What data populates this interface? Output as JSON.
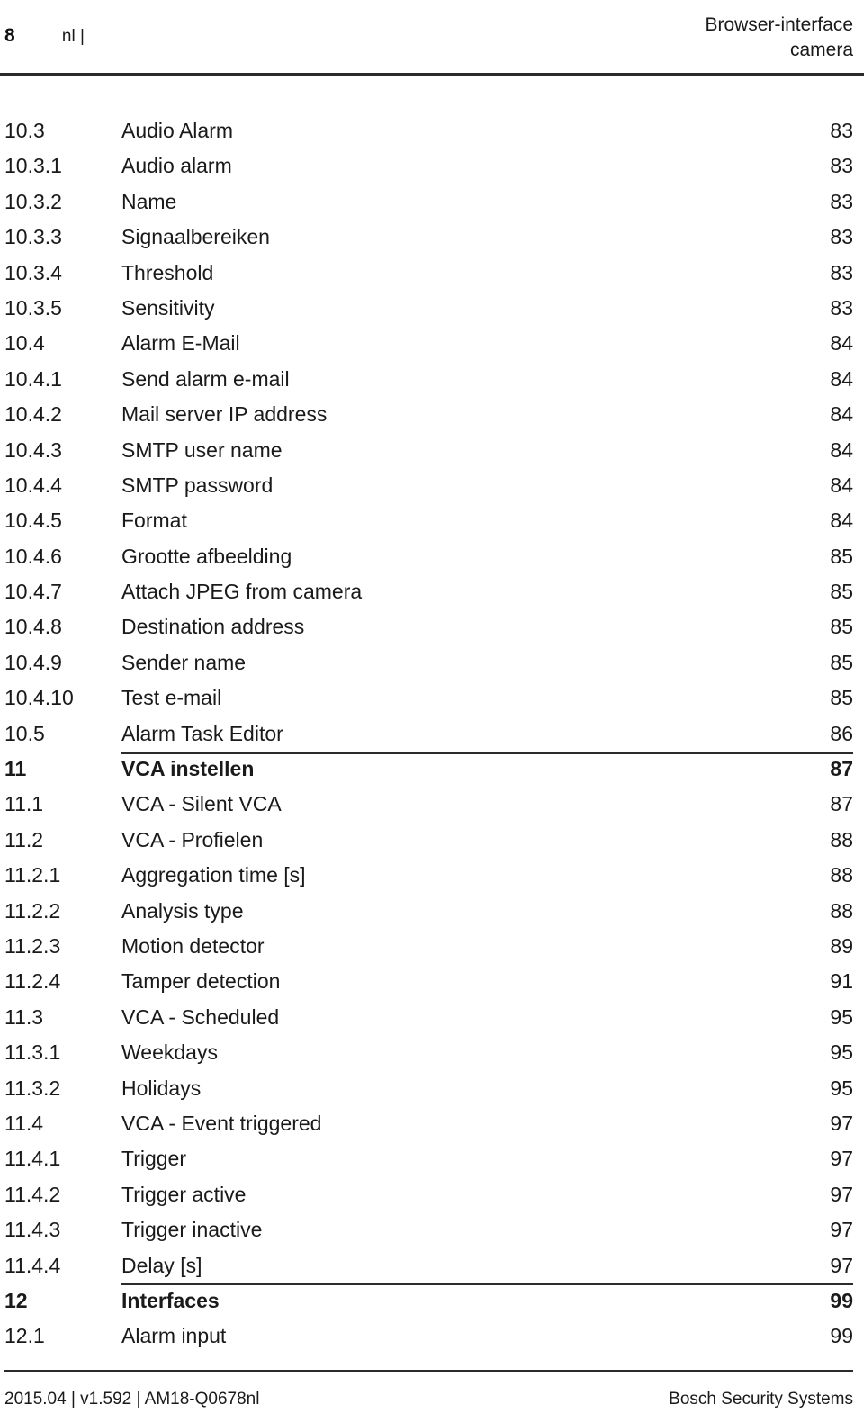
{
  "header": {
    "page_number": "8",
    "language": "nl |",
    "title_line1": "Browser-interface",
    "title_line2": "camera"
  },
  "toc": {
    "entries": [
      {
        "number": "10.3",
        "title": "Audio Alarm",
        "page": "83",
        "bold": false,
        "rule_above": false
      },
      {
        "number": "10.3.1",
        "title": "Audio alarm",
        "page": "83",
        "bold": false,
        "rule_above": false
      },
      {
        "number": "10.3.2",
        "title": "Name",
        "page": "83",
        "bold": false,
        "rule_above": false
      },
      {
        "number": "10.3.3",
        "title": "Signaalbereiken",
        "page": "83",
        "bold": false,
        "rule_above": false
      },
      {
        "number": "10.3.4",
        "title": "Threshold",
        "page": "83",
        "bold": false,
        "rule_above": false
      },
      {
        "number": "10.3.5",
        "title": "Sensitivity",
        "page": "83",
        "bold": false,
        "rule_above": false
      },
      {
        "number": "10.4",
        "title": "Alarm E-Mail",
        "page": "84",
        "bold": false,
        "rule_above": false
      },
      {
        "number": "10.4.1",
        "title": "Send alarm e-mail",
        "page": "84",
        "bold": false,
        "rule_above": false
      },
      {
        "number": "10.4.2",
        "title": "Mail server IP address",
        "page": "84",
        "bold": false,
        "rule_above": false
      },
      {
        "number": "10.4.3",
        "title": "SMTP user name",
        "page": "84",
        "bold": false,
        "rule_above": false
      },
      {
        "number": "10.4.4",
        "title": "SMTP password",
        "page": "84",
        "bold": false,
        "rule_above": false
      },
      {
        "number": "10.4.5",
        "title": "Format",
        "page": "84",
        "bold": false,
        "rule_above": false
      },
      {
        "number": "10.4.6",
        "title": "Grootte afbeelding",
        "page": "85",
        "bold": false,
        "rule_above": false
      },
      {
        "number": "10.4.7",
        "title": "Attach JPEG from camera",
        "page": "85",
        "bold": false,
        "rule_above": false
      },
      {
        "number": "10.4.8",
        "title": "Destination address",
        "page": "85",
        "bold": false,
        "rule_above": false
      },
      {
        "number": "10.4.9",
        "title": "Sender name",
        "page": "85",
        "bold": false,
        "rule_above": false
      },
      {
        "number": "10.4.10",
        "title": "Test e-mail",
        "page": "85",
        "bold": false,
        "rule_above": false
      },
      {
        "number": "10.5",
        "title": "Alarm Task Editor",
        "page": "86",
        "bold": false,
        "rule_above": false
      },
      {
        "number": "11",
        "title": "VCA instellen",
        "page": "87",
        "bold": true,
        "rule_above": true
      },
      {
        "number": "11.1",
        "title": "VCA - Silent VCA",
        "page": "87",
        "bold": false,
        "rule_above": false
      },
      {
        "number": "11.2",
        "title": "VCA - Profielen",
        "page": "88",
        "bold": false,
        "rule_above": false
      },
      {
        "number": "11.2.1",
        "title": "Aggregation time [s]",
        "page": "88",
        "bold": false,
        "rule_above": false
      },
      {
        "number": "11.2.2",
        "title": "Analysis type",
        "page": "88",
        "bold": false,
        "rule_above": false
      },
      {
        "number": "11.2.3",
        "title": "Motion detector",
        "page": "89",
        "bold": false,
        "rule_above": false
      },
      {
        "number": "11.2.4",
        "title": "Tamper detection",
        "page": "91",
        "bold": false,
        "rule_above": false
      },
      {
        "number": "11.3",
        "title": "VCA - Scheduled",
        "page": "95",
        "bold": false,
        "rule_above": false
      },
      {
        "number": "11.3.1",
        "title": "Weekdays",
        "page": "95",
        "bold": false,
        "rule_above": false
      },
      {
        "number": "11.3.2",
        "title": "Holidays",
        "page": "95",
        "bold": false,
        "rule_above": false
      },
      {
        "number": "11.4",
        "title": "VCA - Event triggered",
        "page": "97",
        "bold": false,
        "rule_above": false
      },
      {
        "number": "11.4.1",
        "title": "Trigger",
        "page": "97",
        "bold": false,
        "rule_above": false
      },
      {
        "number": "11.4.2",
        "title": "Trigger active",
        "page": "97",
        "bold": false,
        "rule_above": false
      },
      {
        "number": "11.4.3",
        "title": "Trigger inactive",
        "page": "97",
        "bold": false,
        "rule_above": false
      },
      {
        "number": "11.4.4",
        "title": "Delay [s]",
        "page": "97",
        "bold": false,
        "rule_above": false
      },
      {
        "number": "12",
        "title": "Interfaces",
        "page": "99",
        "bold": true,
        "rule_above": true
      },
      {
        "number": "12.1",
        "title": "Alarm input",
        "page": "99",
        "bold": false,
        "rule_above": false
      }
    ]
  },
  "footer": {
    "left": "2015.04 | v1.592 | AM18-Q0678nl",
    "right": "Bosch Security Systems"
  }
}
